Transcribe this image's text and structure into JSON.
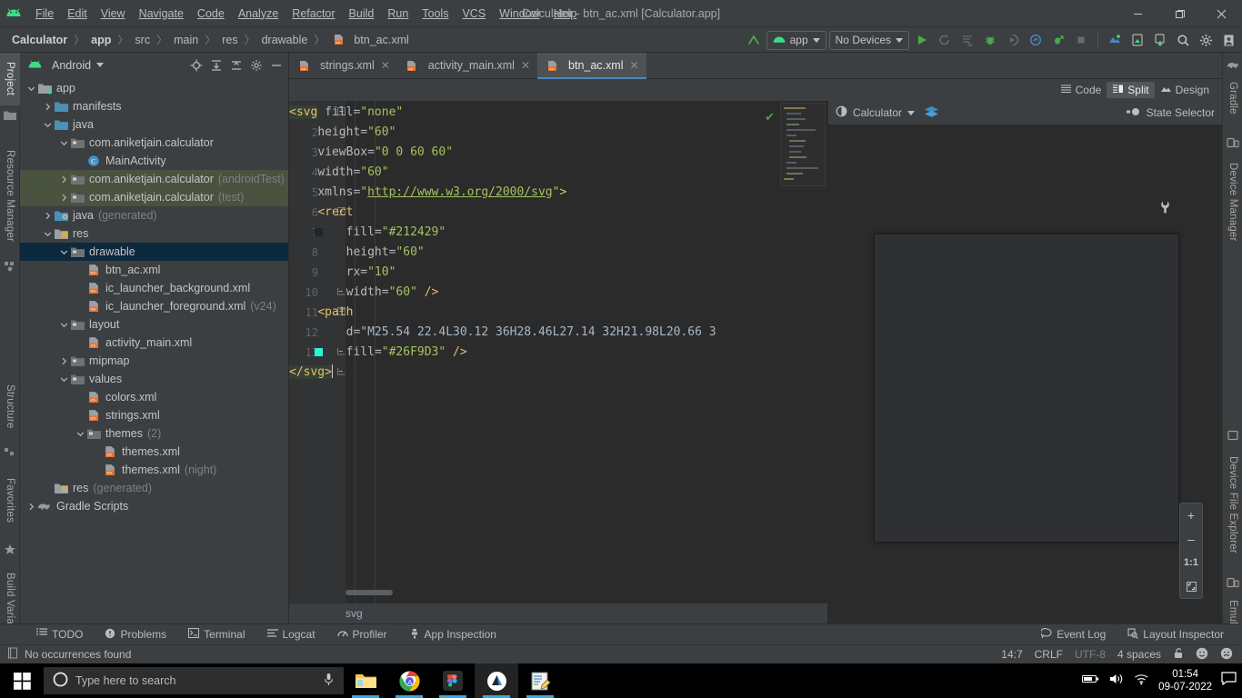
{
  "window": {
    "title": "Calculator - btn_ac.xml [Calculator.app]",
    "minimize": "–",
    "maximize": "❐",
    "close": "✕"
  },
  "menu": [
    {
      "label": "File"
    },
    {
      "label": "Edit"
    },
    {
      "label": "View"
    },
    {
      "label": "Navigate"
    },
    {
      "label": "Code"
    },
    {
      "label": "Analyze"
    },
    {
      "label": "Refactor"
    },
    {
      "label": "Build"
    },
    {
      "label": "Run"
    },
    {
      "label": "Tools"
    },
    {
      "label": "VCS"
    },
    {
      "label": "Window"
    },
    {
      "label": "Help"
    }
  ],
  "breadcrumb": {
    "items": [
      "Calculator",
      "app",
      "src",
      "main",
      "res",
      "drawable"
    ],
    "file": "btn_ac.xml",
    "separator": "〉"
  },
  "toolbar": {
    "run_config": "app",
    "device": "No Devices",
    "icons": [
      "make-project-icon",
      "run-icon",
      "debug-attach-icon",
      "apply-changes-icon",
      "debug-icon",
      "run-coverage-icon",
      "profiler-icon",
      "attach-debugger-icon",
      "stop-icon",
      "sdk-manager-icon",
      "avd-manager-icon",
      "sync-gradle-icon",
      "search-everywhere-icon",
      "settings-icon",
      "account-icon"
    ]
  },
  "left_strip": [
    {
      "label": "Project",
      "selected": true
    },
    {
      "label": "Resource Manager",
      "selected": false
    },
    {
      "label": "Structure",
      "selected": false
    },
    {
      "label": "Favorites",
      "selected": false
    },
    {
      "label": "Build Variants",
      "selected": false
    }
  ],
  "right_strip": [
    {
      "label": "Gradle"
    },
    {
      "label": "Device Manager"
    },
    {
      "label": "Device File Explorer"
    },
    {
      "label": "Emulator"
    }
  ],
  "project_panel": {
    "title": "Android",
    "actions": [
      "select-opened-file-icon",
      "expand-all-icon",
      "collapse-all-icon",
      "settings-icon",
      "hide-icon"
    ],
    "tree": [
      {
        "label": "app",
        "indent": 0,
        "arrow": "down",
        "icon": "module-folder",
        "state": "normal"
      },
      {
        "label": "manifests",
        "indent": 1,
        "arrow": "right",
        "icon": "folder-blue",
        "state": "normal"
      },
      {
        "label": "java",
        "indent": 1,
        "arrow": "down",
        "icon": "folder-blue",
        "state": "normal"
      },
      {
        "label": "com.aniketjain.calculator",
        "indent": 2,
        "arrow": "down",
        "icon": "package",
        "state": "normal"
      },
      {
        "label": "MainActivity",
        "indent": 3,
        "arrow": "none",
        "icon": "class-java",
        "state": "normal"
      },
      {
        "label": "com.aniketjain.calculator",
        "suffix": "(androidTest)",
        "indent": 2,
        "arrow": "right",
        "icon": "package",
        "state": "highlight"
      },
      {
        "label": "com.aniketjain.calculator",
        "suffix": "(test)",
        "indent": 2,
        "arrow": "right",
        "icon": "package",
        "state": "highlight"
      },
      {
        "label": "java",
        "suffix": "(generated)",
        "indent": 1,
        "arrow": "right",
        "icon": "folder-generated",
        "state": "normal"
      },
      {
        "label": "res",
        "indent": 1,
        "arrow": "down",
        "icon": "folder-res",
        "state": "normal"
      },
      {
        "label": "drawable",
        "indent": 2,
        "arrow": "down",
        "icon": "package",
        "state": "selected"
      },
      {
        "label": "btn_ac.xml",
        "indent": 3,
        "arrow": "none",
        "icon": "xml-file",
        "state": "normal"
      },
      {
        "label": "ic_launcher_background.xml",
        "indent": 3,
        "arrow": "none",
        "icon": "xml-file",
        "state": "normal"
      },
      {
        "label": "ic_launcher_foreground.xml",
        "suffix": "(v24)",
        "indent": 3,
        "arrow": "none",
        "icon": "xml-file",
        "state": "normal"
      },
      {
        "label": "layout",
        "indent": 2,
        "arrow": "down",
        "icon": "package",
        "state": "normal"
      },
      {
        "label": "activity_main.xml",
        "indent": 3,
        "arrow": "none",
        "icon": "xml-file",
        "state": "normal"
      },
      {
        "label": "mipmap",
        "indent": 2,
        "arrow": "right",
        "icon": "package",
        "state": "normal"
      },
      {
        "label": "values",
        "indent": 2,
        "arrow": "down",
        "icon": "package",
        "state": "normal"
      },
      {
        "label": "colors.xml",
        "indent": 3,
        "arrow": "none",
        "icon": "xml-file",
        "state": "normal"
      },
      {
        "label": "strings.xml",
        "indent": 3,
        "arrow": "none",
        "icon": "xml-file",
        "state": "normal"
      },
      {
        "label": "themes",
        "suffix": "(2)",
        "indent": 3,
        "arrow": "down",
        "icon": "package",
        "state": "normal"
      },
      {
        "label": "themes.xml",
        "indent": 4,
        "arrow": "none",
        "icon": "xml-file",
        "state": "normal"
      },
      {
        "label": "themes.xml",
        "suffix": "(night)",
        "indent": 4,
        "arrow": "none",
        "icon": "xml-file",
        "state": "normal"
      },
      {
        "label": "res",
        "suffix": "(generated)",
        "indent": 1,
        "arrow": "none",
        "icon": "folder-res",
        "state": "normal"
      },
      {
        "label": "Gradle Scripts",
        "indent": 0,
        "arrow": "right",
        "icon": "gradle",
        "state": "normal"
      }
    ]
  },
  "editor_tabs": [
    {
      "label": "strings.xml",
      "active": false
    },
    {
      "label": "activity_main.xml",
      "active": false
    },
    {
      "label": "btn_ac.xml",
      "active": true
    }
  ],
  "view_modes": [
    {
      "label": "Code",
      "selected": false,
      "icon": "code-view-icon"
    },
    {
      "label": "Split",
      "selected": true,
      "icon": "split-view-icon"
    },
    {
      "label": "Design",
      "selected": false,
      "icon": "design-view-icon"
    }
  ],
  "code": {
    "filename": "btn_ac.xml",
    "breadcrumb": "svg",
    "lines": [
      {
        "n": 1,
        "text": "<svg fill=\"none\""
      },
      {
        "n": 2,
        "text": "    height=\"60\""
      },
      {
        "n": 3,
        "text": "    viewBox=\"0 0 60 60\""
      },
      {
        "n": 4,
        "text": "    width=\"60\""
      },
      {
        "n": 5,
        "text": "    xmlns=\"http://www.w3.org/2000/svg\">"
      },
      {
        "n": 6,
        "text": "    <rect"
      },
      {
        "n": 7,
        "text": "        fill=\"#212429\""
      },
      {
        "n": 8,
        "text": "        height=\"60\""
      },
      {
        "n": 9,
        "text": "        rx=\"10\""
      },
      {
        "n": 10,
        "text": "        width=\"60\" />"
      },
      {
        "n": 11,
        "text": "    <path"
      },
      {
        "n": 12,
        "text": "        d=\"M25.54 22.4L30.12 36H28.46L27.14 32H21.98L20.66 3"
      },
      {
        "n": 13,
        "text": "        fill=\"#26F9D3\" />"
      },
      {
        "n": 14,
        "text": "</svg>"
      }
    ],
    "gutter_color_marks": [
      {
        "line": 7,
        "color": "#212429"
      },
      {
        "line": 13,
        "color": "#26F9D3"
      }
    ],
    "inspection_status": "ok-check-icon"
  },
  "preview": {
    "theme": "Calculator",
    "state_selector": "State Selector",
    "wrench_icon": "wrench-icon",
    "zoom_controls": [
      {
        "label": "+",
        "name": "zoom-in-button"
      },
      {
        "label": "–",
        "name": "zoom-out-button"
      },
      {
        "label": "1:1",
        "name": "zoom-actual-size-button"
      },
      {
        "label": "⛶",
        "name": "zoom-to-fit-button"
      }
    ]
  },
  "bottom_bar": {
    "items": [
      {
        "label": "TODO",
        "icon": "todo-icon"
      },
      {
        "label": "Problems",
        "icon": "problems-icon"
      },
      {
        "label": "Terminal",
        "icon": "terminal-icon"
      },
      {
        "label": "Logcat",
        "icon": "logcat-icon"
      },
      {
        "label": "Profiler",
        "icon": "profiler-icon"
      },
      {
        "label": "App Inspection",
        "icon": "app-inspection-icon"
      }
    ],
    "right_items": [
      {
        "label": "Event Log",
        "icon": "event-log-icon"
      },
      {
        "label": "Layout Inspector",
        "icon": "layout-inspector-icon"
      }
    ]
  },
  "status_bar": {
    "message": "No occurrences found",
    "caret": "14:7",
    "line_sep": "CRLF",
    "encoding": "UTF-8",
    "indent": "4 spaces",
    "lock_icon": "unlocked-icon",
    "faces": [
      "happy-face-icon",
      "sad-face-icon"
    ]
  },
  "taskbar": {
    "start_icon": "windows-start-icon",
    "search_placeholder": "Type here to search",
    "search_icon": "cortana-circle-icon",
    "mic_icon": "microphone-icon",
    "apps": [
      {
        "name": "file-explorer-icon",
        "active": false,
        "running": true
      },
      {
        "name": "google-chrome-icon",
        "active": false,
        "running": true
      },
      {
        "name": "figma-icon",
        "active": false,
        "running": true
      },
      {
        "name": "android-studio-icon",
        "active": true,
        "running": true
      },
      {
        "name": "notepad-editor-icon",
        "active": false,
        "running": true
      }
    ],
    "tray": {
      "battery_icon": "battery-icon",
      "volume_icon": "volume-icon",
      "wifi_icon": "wifi-icon",
      "time": "01:54",
      "date": "09-07-2022",
      "action_center_icon": "action-center-icon"
    }
  }
}
